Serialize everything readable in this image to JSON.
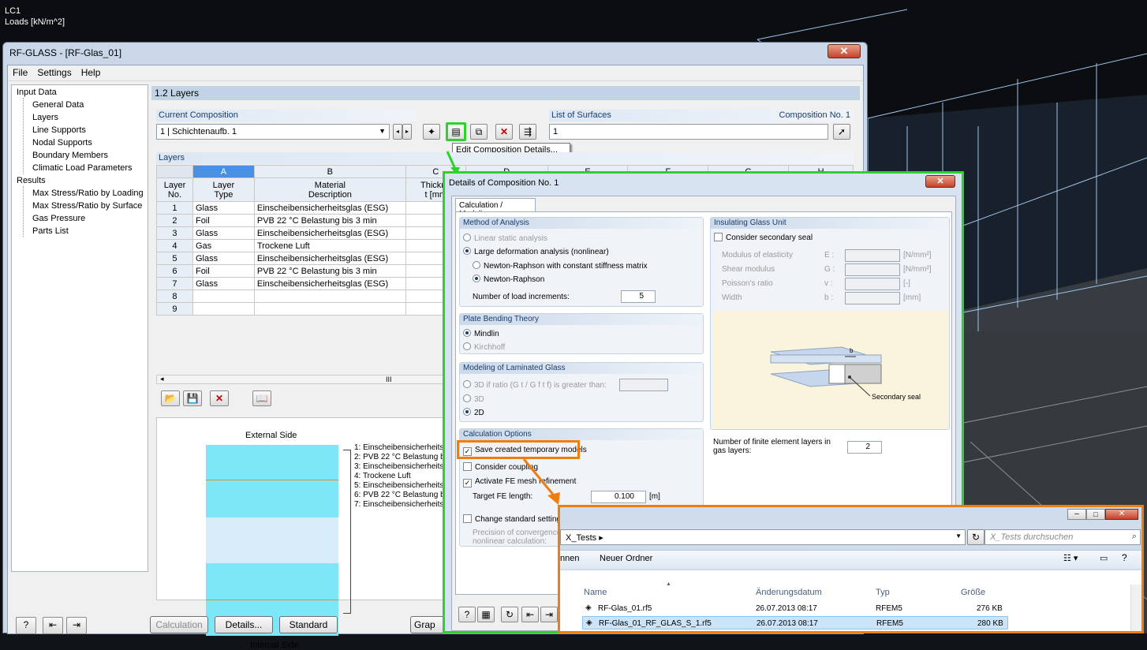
{
  "viewport": {
    "lc": "LC1",
    "loads": "Loads [kN/m^2]"
  },
  "window": {
    "title": "RF-GLASS - [RF-Glas_01]",
    "close": "✕"
  },
  "menu": [
    "File",
    "Settings",
    "Help"
  ],
  "tree": {
    "input_data": "Input Data",
    "input_items": [
      "General Data",
      "Layers",
      "Line Supports",
      "Nodal Supports",
      "Boundary Members",
      "Climatic Load Parameters"
    ],
    "results": "Results",
    "result_items": [
      "Max Stress/Ratio by Loading",
      "Max Stress/Ratio by Surface",
      "Gas Pressure",
      "Parts List"
    ]
  },
  "panel": {
    "title": "1.2 Layers",
    "current_composition": "Current Composition",
    "composition_value": "1 | Schichtenaufb. 1",
    "list_of_surfaces": "List of Surfaces",
    "composition_no": "Composition No. 1",
    "surfaces_value": "1",
    "tooltip": "Edit Composition Details...",
    "layers": "Layers"
  },
  "table": {
    "col_letters": [
      "A",
      "B",
      "C",
      "D",
      "E",
      "F",
      "G",
      "H"
    ],
    "layer_no": [
      "Layer",
      "No."
    ],
    "col_a": [
      "Layer",
      "Type"
    ],
    "col_b": [
      "Material",
      "Description"
    ],
    "col_c": [
      "Thickne",
      "t [mm"
    ],
    "rows": [
      {
        "no": "1",
        "type": "Glass",
        "desc": "Einscheibensicherheitsglas (ESG)"
      },
      {
        "no": "2",
        "type": "Foil",
        "desc": "PVB 22 °C Belastung bis 3 min"
      },
      {
        "no": "3",
        "type": "Glass",
        "desc": "Einscheibensicherheitsglas (ESG)"
      },
      {
        "no": "4",
        "type": "Gas",
        "desc": "Trockene Luft"
      },
      {
        "no": "5",
        "type": "Glass",
        "desc": "Einscheibensicherheitsglas (ESG)"
      },
      {
        "no": "6",
        "type": "Foil",
        "desc": "PVB 22 °C Belastung bis 3 min"
      },
      {
        "no": "7",
        "type": "Glass",
        "desc": "Einscheibensicherheitsglas (ESG)"
      },
      {
        "no": "8",
        "type": "",
        "desc": ""
      },
      {
        "no": "9",
        "type": "",
        "desc": ""
      }
    ],
    "scroll_mark": "III"
  },
  "diagram": {
    "external": "External Side",
    "internal": "Internal Side",
    "labels": [
      "1: Einscheibensicherheits",
      "2: PVB 22 °C Belastung b",
      "3: Einscheibensicherheits",
      "4: Trockene Luft",
      "5: Einscheibensicherheits",
      "6: PVB 22 °C Belastung b",
      "7: Einscheibensicherheits"
    ]
  },
  "bottom": {
    "calculation": "Calculation",
    "details": "Details...",
    "standard": "Standard",
    "graphics": "Grap"
  },
  "dialog": {
    "title": "Details of Composition No. 1",
    "tab": "Calculation / Modeling",
    "method": "Method of Analysis",
    "linear": "Linear static analysis",
    "large_def": "Large deformation analysis (nonlinear)",
    "nr_const": "Newton-Raphson with constant stiffness matrix",
    "nr": "Newton-Raphson",
    "load_incr": "Number of load increments:",
    "load_incr_val": "5",
    "plate": "Plate Bending Theory",
    "mindlin": "Mindlin",
    "kirchhoff": "Kirchhoff",
    "lam": "Modeling of Laminated Glass",
    "lam_3d_if": "3D if ratio (G t / G f t f) is greater than:",
    "lam_3d": "3D",
    "lam_2d": "2D",
    "calc_opts": "Calculation Options",
    "save_temp": "Save created temporary models",
    "coupling": "Consider coupling",
    "fe_refine": "Activate FE mesh refinement",
    "target_fe": "Target FE length:",
    "target_fe_val": "0.100",
    "target_fe_unit": "[m]",
    "change_std": "Change standard settings",
    "precision": "Precision of convergence cri",
    "nonlinear": "nonlinear calculation:",
    "igu": "Insulating Glass Unit",
    "secondary_seal": "Consider secondary seal",
    "props": [
      {
        "name": "Modulus of elasticity",
        "sym": "E :",
        "unit": "[N/mm²]"
      },
      {
        "name": "Shear modulus",
        "sym": "G :",
        "unit": "[N/mm²]"
      },
      {
        "name": "Poisson's ratio",
        "sym": "v :",
        "unit": "[-]"
      },
      {
        "name": "Width",
        "sym": "b :",
        "unit": "[mm]"
      }
    ],
    "seal_label": "Secondary seal",
    "b_label": "b",
    "fe_layers": "Number of finite element layers in gas layers:",
    "fe_layers_val": "2"
  },
  "explorer": {
    "path": "X_Tests",
    "search": "X_Tests durchsuchen",
    "toolbar_left": "nnen",
    "new_folder": "Neuer Ordner",
    "headers": [
      "Name",
      "Änderungsdatum",
      "Typ",
      "Größe"
    ],
    "files": [
      {
        "name": "RF-Glas_01.rf5",
        "date": "26.07.2013 08:17",
        "type": "RFEM5",
        "size": "276 KB"
      },
      {
        "name": "RF-Glas_01_RF_GLAS_S_1.rf5",
        "date": "26.07.2013 08:17",
        "type": "RFEM5",
        "size": "280 KB"
      }
    ]
  }
}
